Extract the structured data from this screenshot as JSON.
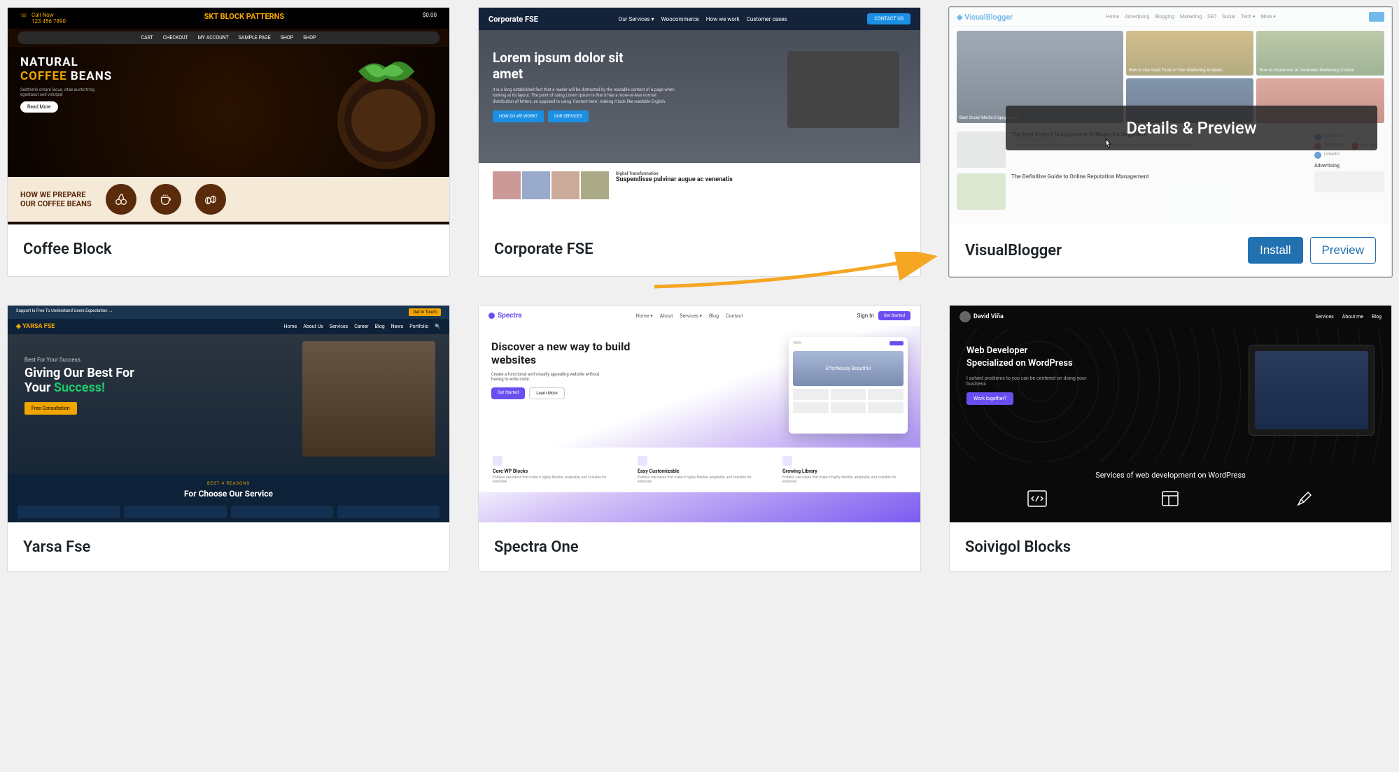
{
  "themes": [
    {
      "id": "coffee-block",
      "title": "Coffee Block",
      "hover": false,
      "preview": {
        "topbar": {
          "callnow": "Call Now",
          "phone": "123 456 7890",
          "logo": "SKT BLOCK PATTERNS",
          "cart": "$0.00"
        },
        "nav": [
          "CART",
          "CHECKOUT",
          "MY ACCOUNT",
          "SAMPLE PAGE",
          "SHOP",
          "SHOP"
        ],
        "hero_line1": "NATURAL",
        "hero_line2_accent": "COFFEE",
        "hero_line2_rest": "BEANS",
        "hero_text": "Sedtristie ornare lacus, vitae auctortring egestasut sed volutpat",
        "cta": "Read More",
        "banner_line1": "HOW WE PREPARE",
        "banner_line2": "OUR COFFEE BEANS"
      }
    },
    {
      "id": "corporate-fse",
      "title": "Corporate FSE",
      "hover": false,
      "preview": {
        "brand": "Corporate FSE",
        "nav": [
          "Our Services ▾",
          "Woocommerce",
          "How we work",
          "Customer cases"
        ],
        "cta": "CONTACT US",
        "hero_title": "Lorem ipsum dolor sit amet",
        "hero_text": "It is a long established fact that a reader will be distracted by the readable content of a page when looking at its layout. The point of using Lorem Ipsum is that it has a more-or-less normal distribution of letters, as opposed to using 'Content here', making it look like readable English.",
        "btn1": "HOW DO WE WORK?",
        "btn2": "OUR SERVICES",
        "article_kicker": "Digital Transformation",
        "article_title": "Suspendisse pulvinar augue ac venenatis"
      }
    },
    {
      "id": "visualblogger",
      "title": "VisualBlogger",
      "hover": true,
      "overlay_text": "Details & Preview",
      "install_label": "Install",
      "preview_label": "Preview",
      "preview": {
        "brand": "VisualBlogger",
        "nav": [
          "Home",
          "Advertising",
          "Blogging",
          "Marketing",
          "SEO",
          "Social",
          "Tech ▾",
          "More ▾"
        ],
        "tiles": [
          "Best Social Media Engagement",
          "How to Use SaaS Tools in Your Marketing Analysis",
          "How to Implement AI Generated Marketing Content"
        ],
        "post1_title": "The Best Project Management Software for Beginners",
        "post1_meta": "John Doe · February 16, 2020",
        "post1_text": "Lorem ipsum dolor sit amet, consectetur adipiscing elit. Integer porta felis non nisl ultrices, maximus tempor ante rec...",
        "post2_title": "The Definitive Guide to Online Reputation Management",
        "social": [
          "Facebook",
          "Instagram",
          "YouTube",
          "LinkedIn"
        ],
        "side_heading": "Advertising"
      }
    },
    {
      "id": "yarsa-fse",
      "title": "Yarsa Fse",
      "hover": false,
      "preview": {
        "topbar": "Support Is Free To Understand Users Expectation →",
        "topbar_btn": "Get In Touch",
        "brand": "YARSA FSE",
        "nav": [
          "Home",
          "About Us",
          "Services",
          "Career",
          "Blog",
          "News",
          "Portfolio"
        ],
        "sub": "Best For Your Success.",
        "hero_line1": "Giving Our Best For",
        "hero_line2_pre": "Your ",
        "hero_line2_acc": "Success!",
        "cta": "Free Consultation",
        "reasons_tag": "BEST 4 REASONS",
        "reasons_heading": "For Choose Our Service"
      }
    },
    {
      "id": "spectra-one",
      "title": "Spectra One",
      "hover": false,
      "preview": {
        "brand": "Spectra",
        "nav": [
          "Home ▾",
          "About",
          "Services ▾",
          "Blog",
          "Contact"
        ],
        "login": "Sign In",
        "cta": "Get Started",
        "hero_title": "Discover a new way to build websites",
        "hero_text": "Create a functional and visually appealing website without having to write code.",
        "btn1": "Get Started",
        "btn2": "Learn More",
        "mock_text": "Effortlessly Beautiful",
        "features": [
          {
            "title": "Core WP Blocks",
            "text": "Endless use-cases that make it highly flexible, adaptable, and scalable for everyone."
          },
          {
            "title": "Easy Customizable",
            "text": "Endless use-cases that make it highly flexible, adaptable, and scalable for everyone."
          },
          {
            "title": "Growing Library",
            "text": "Endless use-cases that make it highly flexible, adaptable, and scalable for everyone."
          }
        ]
      }
    },
    {
      "id": "soivigol-blocks",
      "title": "Soivigol Blocks",
      "hover": false,
      "preview": {
        "brand": "David Viña",
        "nav": [
          "Services",
          "About me",
          "Blog"
        ],
        "hero_line1": "Web Developer",
        "hero_line2": "Specialized on WordPress",
        "hero_text": "I solved problems to you can be centered on doing your business",
        "cta": "Work together?",
        "mid": "Services of web development on WordPress"
      }
    }
  ]
}
